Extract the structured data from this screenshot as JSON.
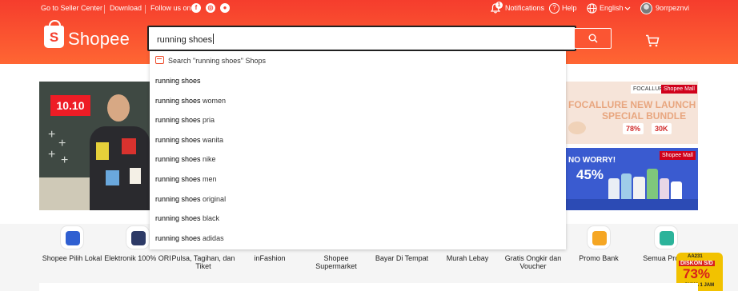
{
  "topbar": {
    "seller_center": "Go to Seller Center",
    "download": "Download",
    "follow_us": "Follow us on",
    "notifications": "Notifications",
    "notifications_badge": "1",
    "help": "Help",
    "language": "English",
    "username": "9orrpeznvi"
  },
  "header": {
    "logo_text": "Shopee",
    "logo_letter": "S",
    "search_value": "running shoes"
  },
  "dropdown": {
    "shop_search": "Search \"running shoes\" Shops",
    "query": "running shoes",
    "suggestions": [
      {
        "suffix": ""
      },
      {
        "suffix": " women"
      },
      {
        "suffix": " pria"
      },
      {
        "suffix": " wanita"
      },
      {
        "suffix": " nike"
      },
      {
        "suffix": " men"
      },
      {
        "suffix": " original"
      },
      {
        "suffix": " black"
      },
      {
        "suffix": " adidas"
      }
    ]
  },
  "banners": {
    "main_tag": "10.10",
    "side1": {
      "tag_left": "FOCALLURE",
      "tag_right": "Shopee Mall",
      "title": "FOCALLURE NEW LAUNCH",
      "subtitle": "SPECIAL BUNDLE",
      "discount": "78%",
      "voucher": "30K"
    },
    "side2": {
      "tag": "Shopee Mall",
      "headline": "NO WORRY!",
      "percent": "45%"
    }
  },
  "categories": [
    {
      "label": "Shopee Pilih Lokal",
      "color": "#2f5fd1"
    },
    {
      "label": "Elektronik 100% ORI",
      "color": "#2d3a66"
    },
    {
      "label": "Pulsa, Tagihan, dan Tiket",
      "color": "#ffffff"
    },
    {
      "label": "inFashion",
      "color": "#ffffff"
    },
    {
      "label": "Shopee Supermarket",
      "color": "#ffffff"
    },
    {
      "label": "Bayar Di Tempat",
      "color": "#ffffff"
    },
    {
      "label": "Murah Lebay",
      "color": "#ffffff"
    },
    {
      "label": "Gratis Ongkir dan Voucher",
      "color": "#ffffff"
    },
    {
      "label": "Promo Bank",
      "color": "#f5a623"
    },
    {
      "label": "Semua Promo",
      "color": "#2bb39a"
    }
  ],
  "promo_badge": {
    "code": "AA231",
    "label": "DISKON S/D",
    "percent": "73%",
    "sub": "CUMA 1 JAM"
  },
  "colors": {
    "brand": "#ee4d2d",
    "search_button": "#fb5533"
  }
}
